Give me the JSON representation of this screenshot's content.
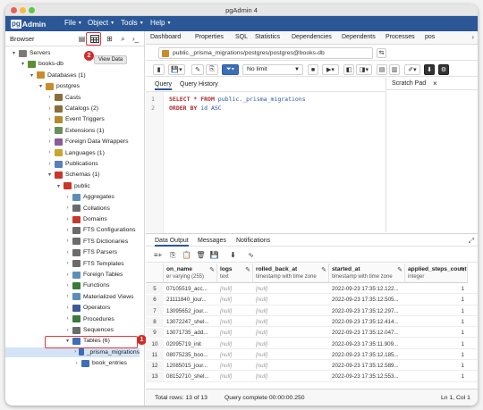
{
  "window": {
    "title": "pgAdmin 4"
  },
  "menubar": {
    "logo_pg": "pg",
    "logo_admin": "Admin",
    "items": [
      "File",
      "Object",
      "Tools",
      "Help"
    ]
  },
  "browser": {
    "label": "Browser",
    "tooltip": "View Data",
    "badge_view_data": "2",
    "badge_tables": "1",
    "tree": [
      {
        "label": "Servers",
        "icon": "servers-icon",
        "color": "#7a7a7a",
        "arrow": "▾"
      },
      {
        "label": "books-db",
        "icon": "server-icon",
        "color": "#5a8f3a",
        "arrow": "▾"
      },
      {
        "label": "Databases (1)",
        "icon": "databases-icon",
        "color": "#c98c2b",
        "arrow": "▾"
      },
      {
        "label": "postgres",
        "icon": "database-icon",
        "color": "#c98c2b",
        "arrow": "▾"
      },
      {
        "label": "Casts",
        "icon": "casts-icon",
        "color": "#8a6d3b",
        "arrow": "›"
      },
      {
        "label": "Catalogs (2)",
        "icon": "catalogs-icon",
        "color": "#8a6d3b",
        "arrow": "›"
      },
      {
        "label": "Event Triggers",
        "icon": "event-triggers-icon",
        "color": "#b38a2d",
        "arrow": "›"
      },
      {
        "label": "Extensions (1)",
        "icon": "extensions-icon",
        "color": "#6b8f5a",
        "arrow": "›"
      },
      {
        "label": "Foreign Data Wrappers",
        "icon": "fdw-icon",
        "color": "#8a5a9a",
        "arrow": "›"
      },
      {
        "label": "Languages (1)",
        "icon": "languages-icon",
        "color": "#c9a62b",
        "arrow": "›"
      },
      {
        "label": "Publications",
        "icon": "publications-icon",
        "color": "#5a7fb8",
        "arrow": "›"
      },
      {
        "label": "Schemas (1)",
        "icon": "schemas-icon",
        "color": "#c9362b",
        "arrow": "▾"
      },
      {
        "label": "public",
        "icon": "schema-icon",
        "color": "#c9362b",
        "arrow": "▾"
      },
      {
        "label": "Aggregates",
        "icon": "aggregates-icon",
        "color": "#5a8fb8",
        "arrow": "›"
      },
      {
        "label": "Collations",
        "icon": "collations-icon",
        "color": "#6b6b6b",
        "arrow": "›"
      },
      {
        "label": "Domains",
        "icon": "domains-icon",
        "color": "#c9362b",
        "arrow": "›"
      },
      {
        "label": "FTS Configurations",
        "icon": "fts-config-icon",
        "color": "#6b6b6b",
        "arrow": "›"
      },
      {
        "label": "FTS Dictionaries",
        "icon": "fts-dict-icon",
        "color": "#6b6b6b",
        "arrow": "›"
      },
      {
        "label": "FTS Parsers",
        "icon": "fts-parsers-icon",
        "color": "#6b6b6b",
        "arrow": "›"
      },
      {
        "label": "FTS Templates",
        "icon": "fts-templates-icon",
        "color": "#6b6b6b",
        "arrow": "›"
      },
      {
        "label": "Foreign Tables",
        "icon": "foreign-tables-icon",
        "color": "#5a8fb8",
        "arrow": "›"
      },
      {
        "label": "Functions",
        "icon": "functions-icon",
        "color": "#3a7a3a",
        "arrow": "›"
      },
      {
        "label": "Materialized Views",
        "icon": "mat-views-icon",
        "color": "#5a8fb8",
        "arrow": "›"
      },
      {
        "label": "Operators",
        "icon": "operators-icon",
        "color": "#3a5a9a",
        "arrow": "›"
      },
      {
        "label": "Procedures",
        "icon": "procedures-icon",
        "color": "#3a7a3a",
        "arrow": "›"
      },
      {
        "label": "Sequences",
        "icon": "sequences-icon",
        "color": "#6b6b6b",
        "arrow": "›"
      },
      {
        "label": "Tables (6)",
        "icon": "tables-icon",
        "color": "#3a6fb8",
        "arrow": "▾"
      },
      {
        "label": "_prisma_migrations",
        "icon": "table-icon",
        "color": "#3a6fb8",
        "arrow": "›"
      },
      {
        "label": "book_entries",
        "icon": "table-icon",
        "color": "#3a6fb8",
        "arrow": "›"
      }
    ]
  },
  "tabs": [
    "Dashboard",
    "Properties",
    "SQL",
    "Statistics",
    "Dependencies",
    "Dependents",
    "Processes",
    "pos"
  ],
  "connection": {
    "label": "public._prisma_migrations/postgres/postgres@books-db"
  },
  "toolbar": {
    "limit": "No limit"
  },
  "query_tabs": {
    "query": "Query",
    "history": "Query History",
    "scratch": "Scratch Pad"
  },
  "editor": {
    "line1_num": "1",
    "line2_num": "2",
    "line1_a": "SELECT * FROM ",
    "line1_b": "public._prisma_migrations",
    "line2_a": "ORDER BY ",
    "line2_b": "id ASC"
  },
  "results": {
    "tabs": [
      "Data Output",
      "Messages",
      "Notifications"
    ],
    "columns": [
      {
        "name": "on_name",
        "type": "er varying (255)"
      },
      {
        "name": "logs",
        "type": "text"
      },
      {
        "name": "rolled_back_at",
        "type": "timestamp with time zone"
      },
      {
        "name": "started_at",
        "type": "timestamp with time zone"
      },
      {
        "name": "applied_steps_count",
        "type": "integer"
      }
    ],
    "rows": [
      {
        "n": "5",
        "name": "07105519_acc...",
        "logs": "[null]",
        "rolled": "[null]",
        "started": "2022-09-23 17:35:12.122...",
        "steps": "1"
      },
      {
        "n": "6",
        "name": "21111840_jour...",
        "logs": "[null]",
        "rolled": "[null]",
        "started": "2022-09-23 17:35:12.505...",
        "steps": "1"
      },
      {
        "n": "7",
        "name": "13095652_jour...",
        "logs": "[null]",
        "rolled": "[null]",
        "started": "2022-09-23 17:35:12.297...",
        "steps": "1"
      },
      {
        "n": "8",
        "name": "13072247_shel...",
        "logs": "[null]",
        "rolled": "[null]",
        "started": "2022-09-23 17:35:12.414...",
        "steps": "1"
      },
      {
        "n": "9",
        "name": "13071735_add...",
        "logs": "[null]",
        "rolled": "[null]",
        "started": "2022-09-23 17:35:12.047...",
        "steps": "1"
      },
      {
        "n": "10",
        "name": "02095719_init",
        "logs": "[null]",
        "rolled": "[null]",
        "started": "2022-09-23 17:35:11.909...",
        "steps": "1"
      },
      {
        "n": "11",
        "name": "08075235_boo...",
        "logs": "[null]",
        "rolled": "[null]",
        "started": "2022-09-23 17:35:12.185...",
        "steps": "1"
      },
      {
        "n": "12",
        "name": "12085015_jour...",
        "logs": "[null]",
        "rolled": "[null]",
        "started": "2022-09-23 17:35:12.589...",
        "steps": "1"
      },
      {
        "n": "13",
        "name": "08152710_shel...",
        "logs": "[null]",
        "rolled": "[null]",
        "started": "2022-09-23 17:35:12.553...",
        "steps": "1"
      }
    ]
  },
  "status": {
    "rows": "Total rows: 13 of 13",
    "query": "Query complete 00:00:00.250",
    "pos": "Ln 1, Col 1"
  },
  "colors": {
    "menubar": "#2b5797",
    "highlight": "#e03a3a",
    "badge": "#d22b2b"
  }
}
